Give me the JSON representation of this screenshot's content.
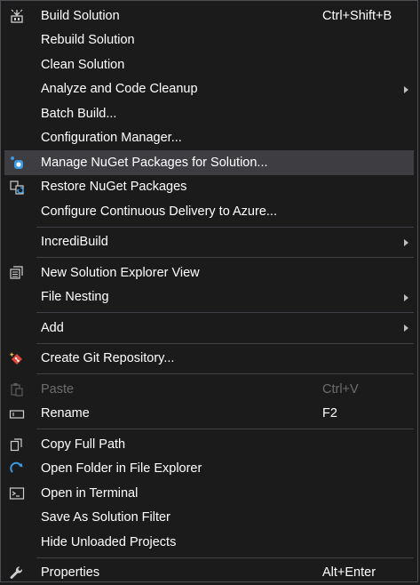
{
  "menu": {
    "items": [
      {
        "label": "Build Solution",
        "shortcut": "Ctrl+Shift+B",
        "icon": "build-icon"
      },
      {
        "label": "Rebuild Solution"
      },
      {
        "label": "Clean Solution"
      },
      {
        "label": "Analyze and Code Cleanup",
        "submenu": true
      },
      {
        "label": "Batch Build..."
      },
      {
        "label": "Configuration Manager..."
      },
      {
        "label": "Manage NuGet Packages for Solution...",
        "icon": "nuget-icon",
        "highlighted": true
      },
      {
        "label": "Restore NuGet Packages",
        "icon": "restore-packages-icon"
      },
      {
        "label": "Configure Continuous Delivery to Azure..."
      },
      {
        "label": "IncrediBuild",
        "submenu": true
      },
      {
        "label": "New Solution Explorer View",
        "icon": "new-explorer-view-icon"
      },
      {
        "label": "File Nesting",
        "submenu": true
      },
      {
        "label": "Add",
        "submenu": true
      },
      {
        "label": "Create Git Repository...",
        "icon": "git-repository-icon"
      },
      {
        "label": "Paste",
        "shortcut": "Ctrl+V",
        "icon": "paste-icon",
        "disabled": true
      },
      {
        "label": "Rename",
        "shortcut": "F2",
        "icon": "rename-icon"
      },
      {
        "label": "Copy Full Path",
        "icon": "copy-icon"
      },
      {
        "label": "Open Folder in File Explorer",
        "icon": "open-folder-icon"
      },
      {
        "label": "Open in Terminal",
        "icon": "terminal-icon"
      },
      {
        "label": "Save As Solution Filter"
      },
      {
        "label": "Hide Unloaded Projects"
      },
      {
        "label": "Properties",
        "shortcut": "Alt+Enter",
        "icon": "wrench-icon"
      }
    ]
  },
  "colors": {
    "background": "#1b1b1c",
    "highlight": "#3e3e42",
    "separator": "#3f3f46",
    "text": "#ffffff",
    "disabled_text": "#6d6d6d",
    "accent_blue": "#3b9ae1",
    "git_red": "#e0483a"
  }
}
